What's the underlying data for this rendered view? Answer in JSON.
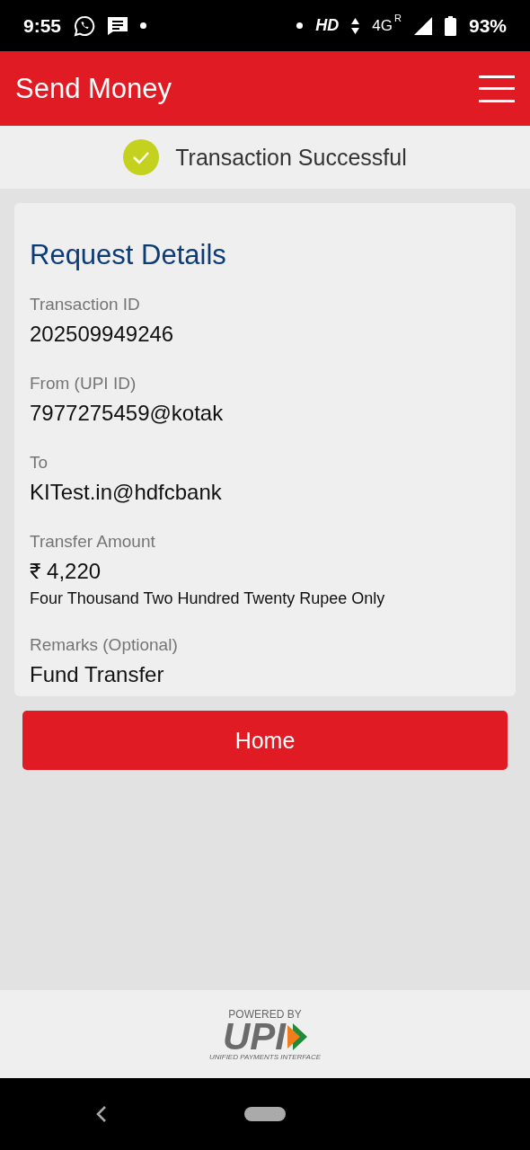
{
  "status_bar": {
    "time": "9:55",
    "network": "HD",
    "network_type": "4G",
    "roaming": "R",
    "battery": "93%"
  },
  "header": {
    "title": "Send Money"
  },
  "banner": {
    "message": "Transaction Successful"
  },
  "card": {
    "title": "Request Details",
    "fields": [
      {
        "label": "Transaction ID",
        "value": "202509949246"
      },
      {
        "label": "From (UPI ID)",
        "value": "7977275459@kotak"
      },
      {
        "label": "To",
        "value": "KITest.in@hdfcbank"
      },
      {
        "label": "Transfer Amount",
        "value": "₹ 4,220",
        "note": "Four Thousand Two Hundred Twenty Rupee Only"
      },
      {
        "label": "Remarks (Optional)",
        "value": "Fund Transfer"
      }
    ]
  },
  "button": {
    "label": "Home"
  },
  "footer": {
    "powered_by": "POWERED BY",
    "logo": "UPI",
    "tagline": "UNIFIED PAYMENTS INTERFACE"
  }
}
